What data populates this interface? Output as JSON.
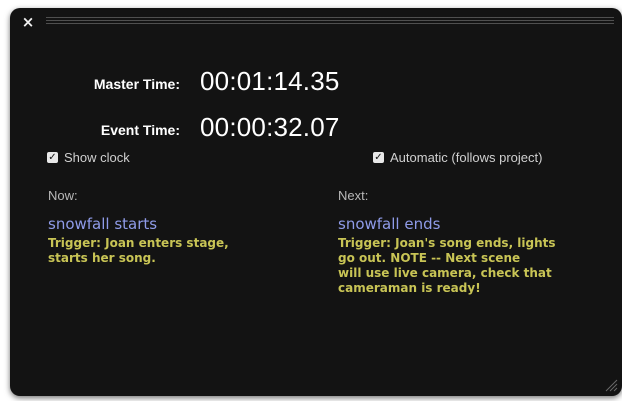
{
  "window": {
    "close_glyph": "×"
  },
  "clock": {
    "master_label": "Master Time:",
    "master_value": "00:01:14.35",
    "event_label": "Event Time:",
    "event_value": "00:00:32.07"
  },
  "options": {
    "show_clock_label": "Show clock",
    "show_clock_checked": true,
    "automatic_label": "Automatic (follows project)",
    "automatic_checked": true,
    "check_glyph": "✓"
  },
  "now": {
    "heading": "Now:",
    "event_name": "snowfall starts",
    "trigger": "Trigger: Joan enters stage,\nstarts her song."
  },
  "next": {
    "heading": "Next:",
    "event_name": "snowfall ends",
    "trigger": "Trigger: Joan's song ends, lights\ngo out.  NOTE -- Next scene\nwill use live camera, check that\ncameraman is ready!"
  },
  "colors": {
    "background": "#131313",
    "event_name": "#8f9be8",
    "trigger_text": "#c8c455"
  },
  "icons": {
    "close": "close-icon",
    "checkbox": "checkbox-icon",
    "resize": "resize-grip-icon"
  }
}
